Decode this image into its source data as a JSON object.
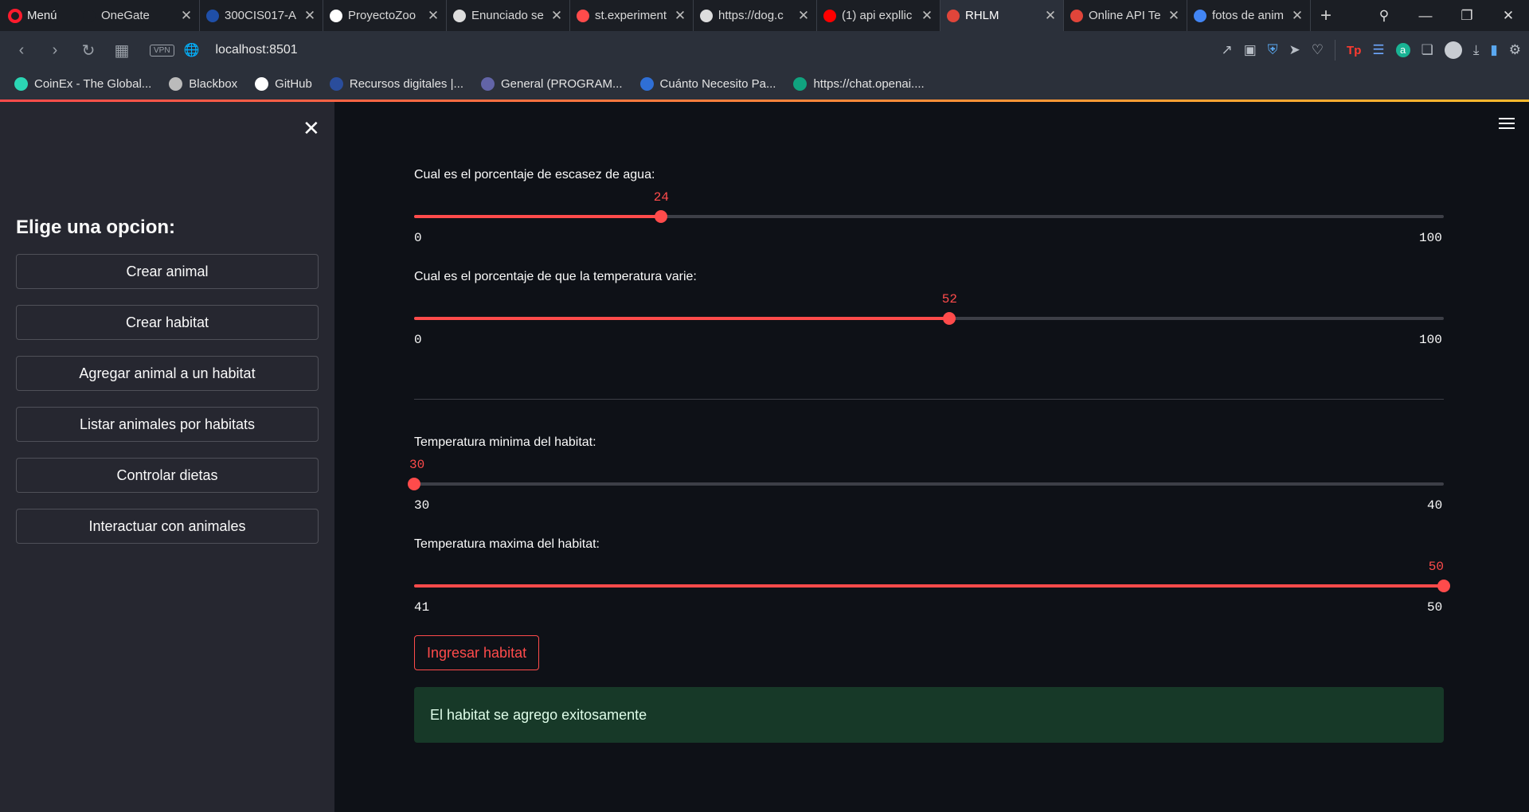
{
  "browser": {
    "menu_label": "Menú",
    "tabs": [
      {
        "title": "OneGate",
        "icon": "onegate-icon",
        "color": "#1b1e24"
      },
      {
        "title": "300CIS017-A",
        "icon": "moodle-icon",
        "color": "#1f4fa8"
      },
      {
        "title": "ProyectoZoo",
        "icon": "github-icon",
        "color": "#ffffff"
      },
      {
        "title": "Enunciado se",
        "icon": "globe-icon",
        "color": "#dddddd"
      },
      {
        "title": "st.experiment",
        "icon": "streamlit-icon",
        "color": "#ff4b4b"
      },
      {
        "title": "https://dog.c",
        "icon": "globe-icon",
        "color": "#dddddd"
      },
      {
        "title": "(1) api expllic",
        "icon": "youtube-icon",
        "color": "#ff0000"
      },
      {
        "title": "RHLM",
        "icon": "devil-icon",
        "color": "#e0453a"
      },
      {
        "title": "Online API Te",
        "icon": "api-icon",
        "color": "#e0453a"
      },
      {
        "title": "fotos de anim",
        "icon": "google-icon",
        "color": "#4285f4"
      }
    ],
    "url": "localhost:8501",
    "vpn_label": "VPN",
    "bookmarks": [
      {
        "label": "CoinEx - The Global...",
        "color": "#2bd6b4"
      },
      {
        "label": "Blackbox",
        "color": "#bbbbbb"
      },
      {
        "label": "GitHub",
        "color": "#ffffff"
      },
      {
        "label": "Recursos digitales |...",
        "color": "#2a4d9c"
      },
      {
        "label": "General (PROGRAM...",
        "color": "#6264a7"
      },
      {
        "label": "Cuánto Necesito Pa...",
        "color": "#2f6fd6"
      },
      {
        "label": "https://chat.openai....",
        "color": "#10a37f"
      }
    ]
  },
  "sidebar": {
    "heading": "Elige una opcion:",
    "buttons": [
      "Crear animal",
      "Crear habitat",
      "Agregar animal a un habitat",
      "Listar animales por habitats",
      "Controlar dietas",
      "Interactuar con animales"
    ]
  },
  "main": {
    "sliders": [
      {
        "label": "Cual es el porcentaje de escasez de agua:",
        "min": "0",
        "max": "100",
        "value": "24"
      },
      {
        "label": "Cual es el porcentaje de que la temperatura varie:",
        "min": "0",
        "max": "100",
        "value": "52"
      },
      {
        "label": "Temperatura minima del habitat:",
        "min": "30",
        "max": "40",
        "value": "30"
      },
      {
        "label": "Temperatura maxima del habitat:",
        "min": "41",
        "max": "50",
        "value": "50"
      }
    ],
    "submit_label": "Ingresar habitat",
    "success_message": "El habitat se agrego exitosamente"
  },
  "colors": {
    "accent": "#ff4b4b",
    "success_bg": "#173928",
    "sidebar_bg": "#262730",
    "main_bg": "#0e1117"
  }
}
